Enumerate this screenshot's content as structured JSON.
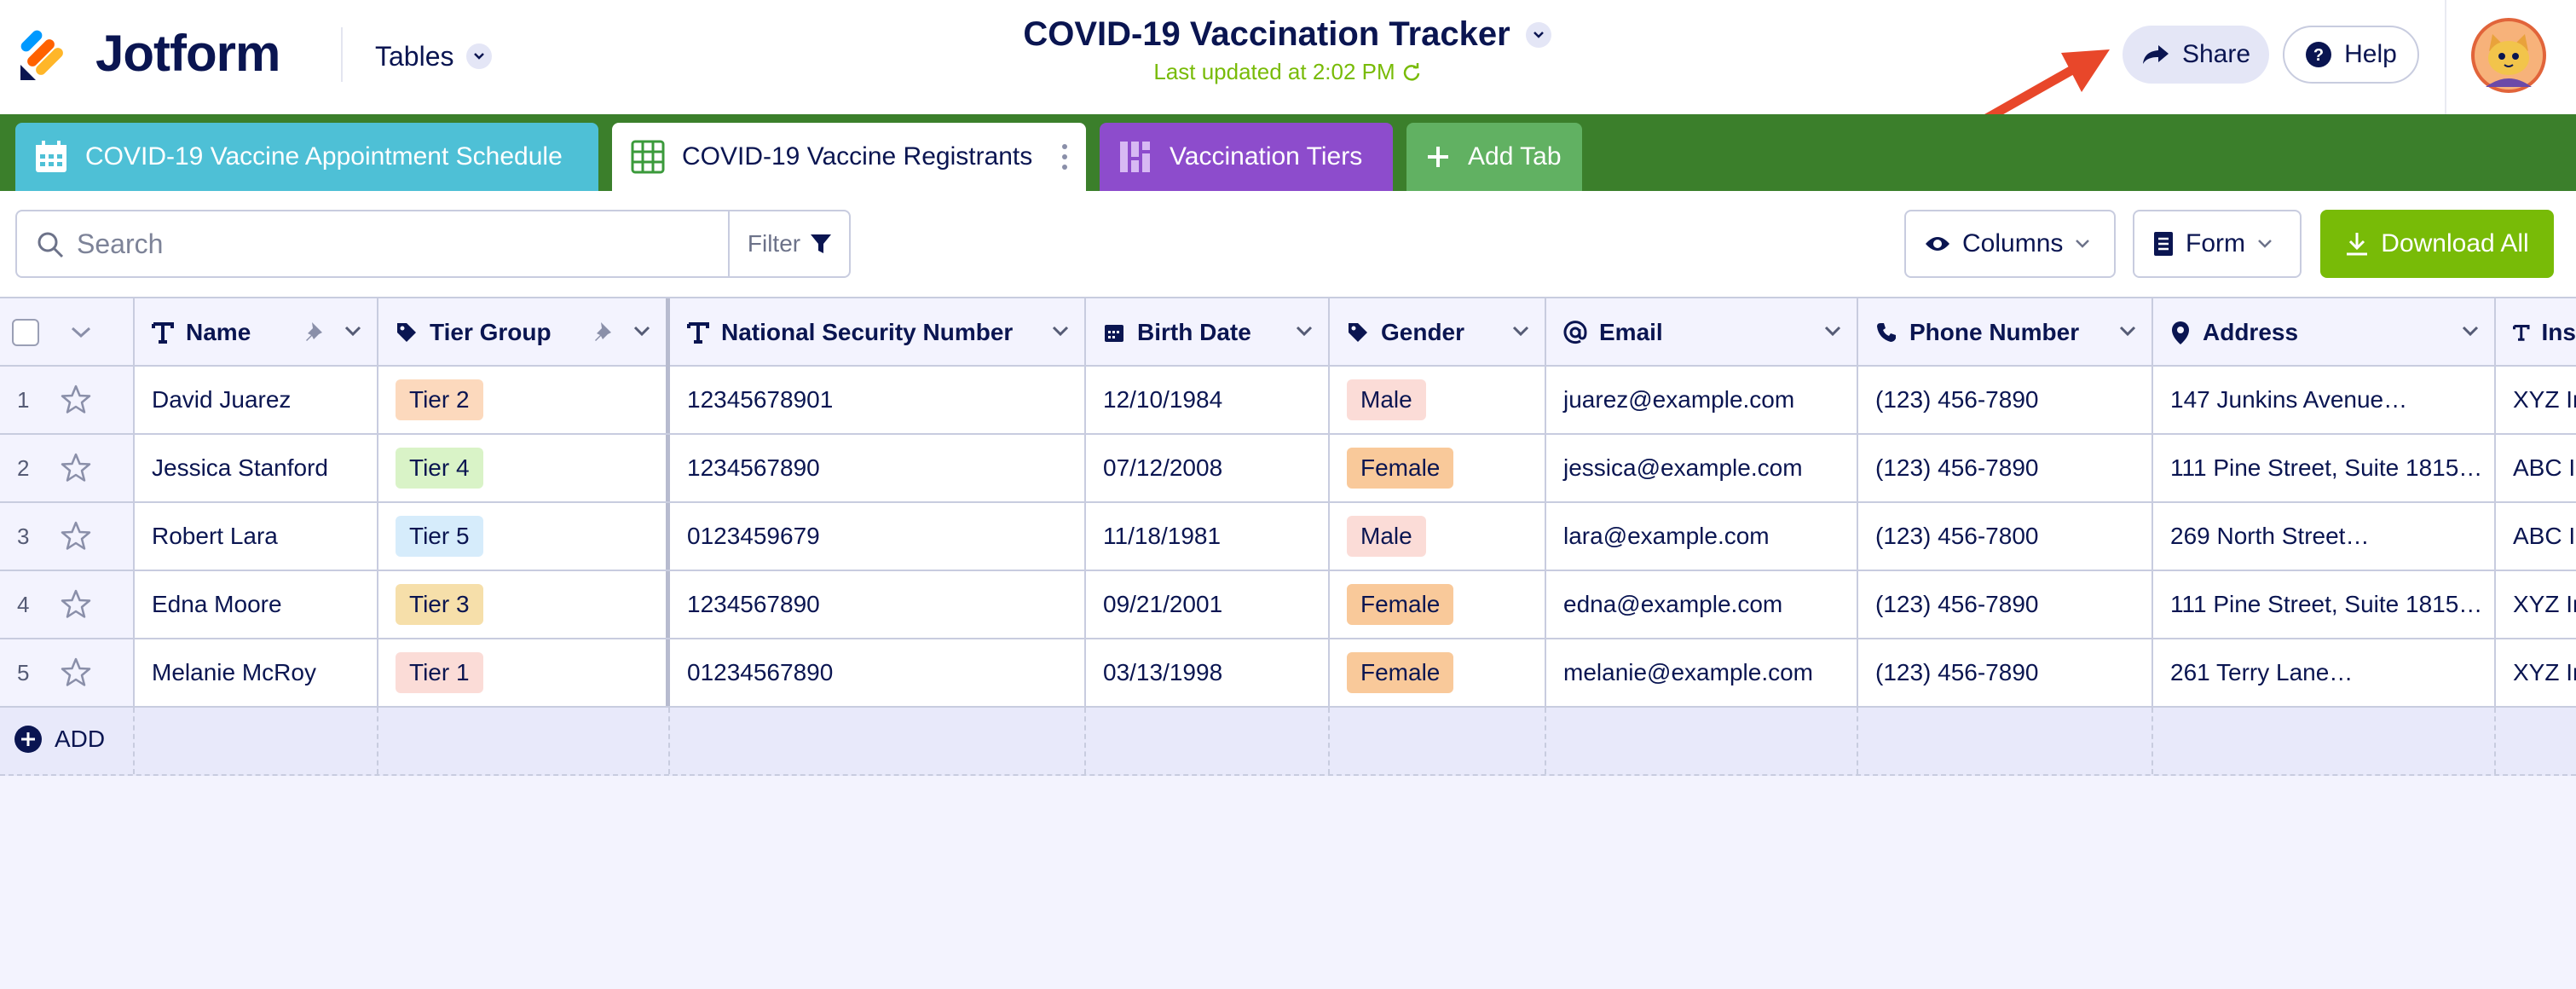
{
  "app": {
    "brand": "Jotform",
    "menu_label": "Tables",
    "title": "COVID-19 Vaccination Tracker",
    "last_updated": "Last updated at 2:02 PM",
    "share_label": "Share",
    "help_label": "Help"
  },
  "tabs": [
    {
      "label": "COVID-19 Vaccine Appointment Schedule",
      "icon": "calendar-icon",
      "color": "#4ec0d6"
    },
    {
      "label": "COVID-19 Vaccine Registrants",
      "icon": "table-grid-icon",
      "color": "#ffffff",
      "active": true
    },
    {
      "label": "Vaccination Tiers",
      "icon": "report-icon",
      "color": "#8d4ccc"
    },
    {
      "label": "Add Tab",
      "icon": "plus-icon",
      "color": "#61b162"
    }
  ],
  "toolbar": {
    "search_placeholder": "Search",
    "filter_label": "Filter",
    "columns_label": "Columns",
    "form_label": "Form",
    "download_label": "Download All"
  },
  "table": {
    "columns": [
      {
        "label": "Name",
        "icon": "text-icon"
      },
      {
        "label": "Tier Group",
        "icon": "tag-icon"
      },
      {
        "label": "National Security Number",
        "icon": "text-icon"
      },
      {
        "label": "Birth Date",
        "icon": "calendar-icon"
      },
      {
        "label": "Gender",
        "icon": "tag-icon"
      },
      {
        "label": "Email",
        "icon": "at-icon"
      },
      {
        "label": "Phone Number",
        "icon": "phone-icon"
      },
      {
        "label": "Address",
        "icon": "location-pin-icon"
      },
      {
        "label": "Ins",
        "icon": "text-icon"
      }
    ],
    "rows": [
      {
        "num": "1",
        "name": "David Juarez",
        "tier": "Tier 2",
        "nsn": "12345678901",
        "birth": "12/10/1984",
        "gender": "Male",
        "email": "juarez@example.com",
        "phone": "(123) 456-7890",
        "address": "147 Junkins Avenue…",
        "ins": "XYZ In"
      },
      {
        "num": "2",
        "name": "Jessica Stanford",
        "tier": "Tier 4",
        "nsn": "1234567890",
        "birth": "07/12/2008",
        "gender": "Female",
        "email": "jessica@example.com",
        "phone": "(123) 456-7890",
        "address": "111 Pine Street, Suite 1815…",
        "ins": "ABC In"
      },
      {
        "num": "3",
        "name": "Robert Lara",
        "tier": "Tier 5",
        "nsn": "0123459679",
        "birth": "11/18/1981",
        "gender": "Male",
        "email": "lara@example.com",
        "phone": "(123) 456-7800",
        "address": "269 North Street…",
        "ins": "ABC In"
      },
      {
        "num": "4",
        "name": "Edna Moore",
        "tier": "Tier 3",
        "nsn": "1234567890",
        "birth": "09/21/2001",
        "gender": "Female",
        "email": "edna@example.com",
        "phone": "(123) 456-7890",
        "address": "111 Pine Street, Suite 1815…",
        "ins": "XYZ In"
      },
      {
        "num": "5",
        "name": "Melanie McRoy",
        "tier": "Tier 1",
        "nsn": "01234567890",
        "birth": "03/13/1998",
        "gender": "Female",
        "email": "melanie@example.com",
        "phone": "(123) 456-7890",
        "address": "261 Terry Lane…",
        "ins": "XYZ In"
      }
    ],
    "add_label": "ADD"
  },
  "colors": {
    "tier_1": "#fbdcd7",
    "tier_2": "#fcd9bd",
    "tier_3": "#f6dfaa",
    "tier_4": "#d9f3c7",
    "tier_5": "#d6ecfb",
    "male": "#fbdcd7",
    "female": "#f9c99a",
    "accent_green": "#78bb07",
    "tab_bar": "#3b7f2b",
    "arrow": "#e8472a"
  }
}
